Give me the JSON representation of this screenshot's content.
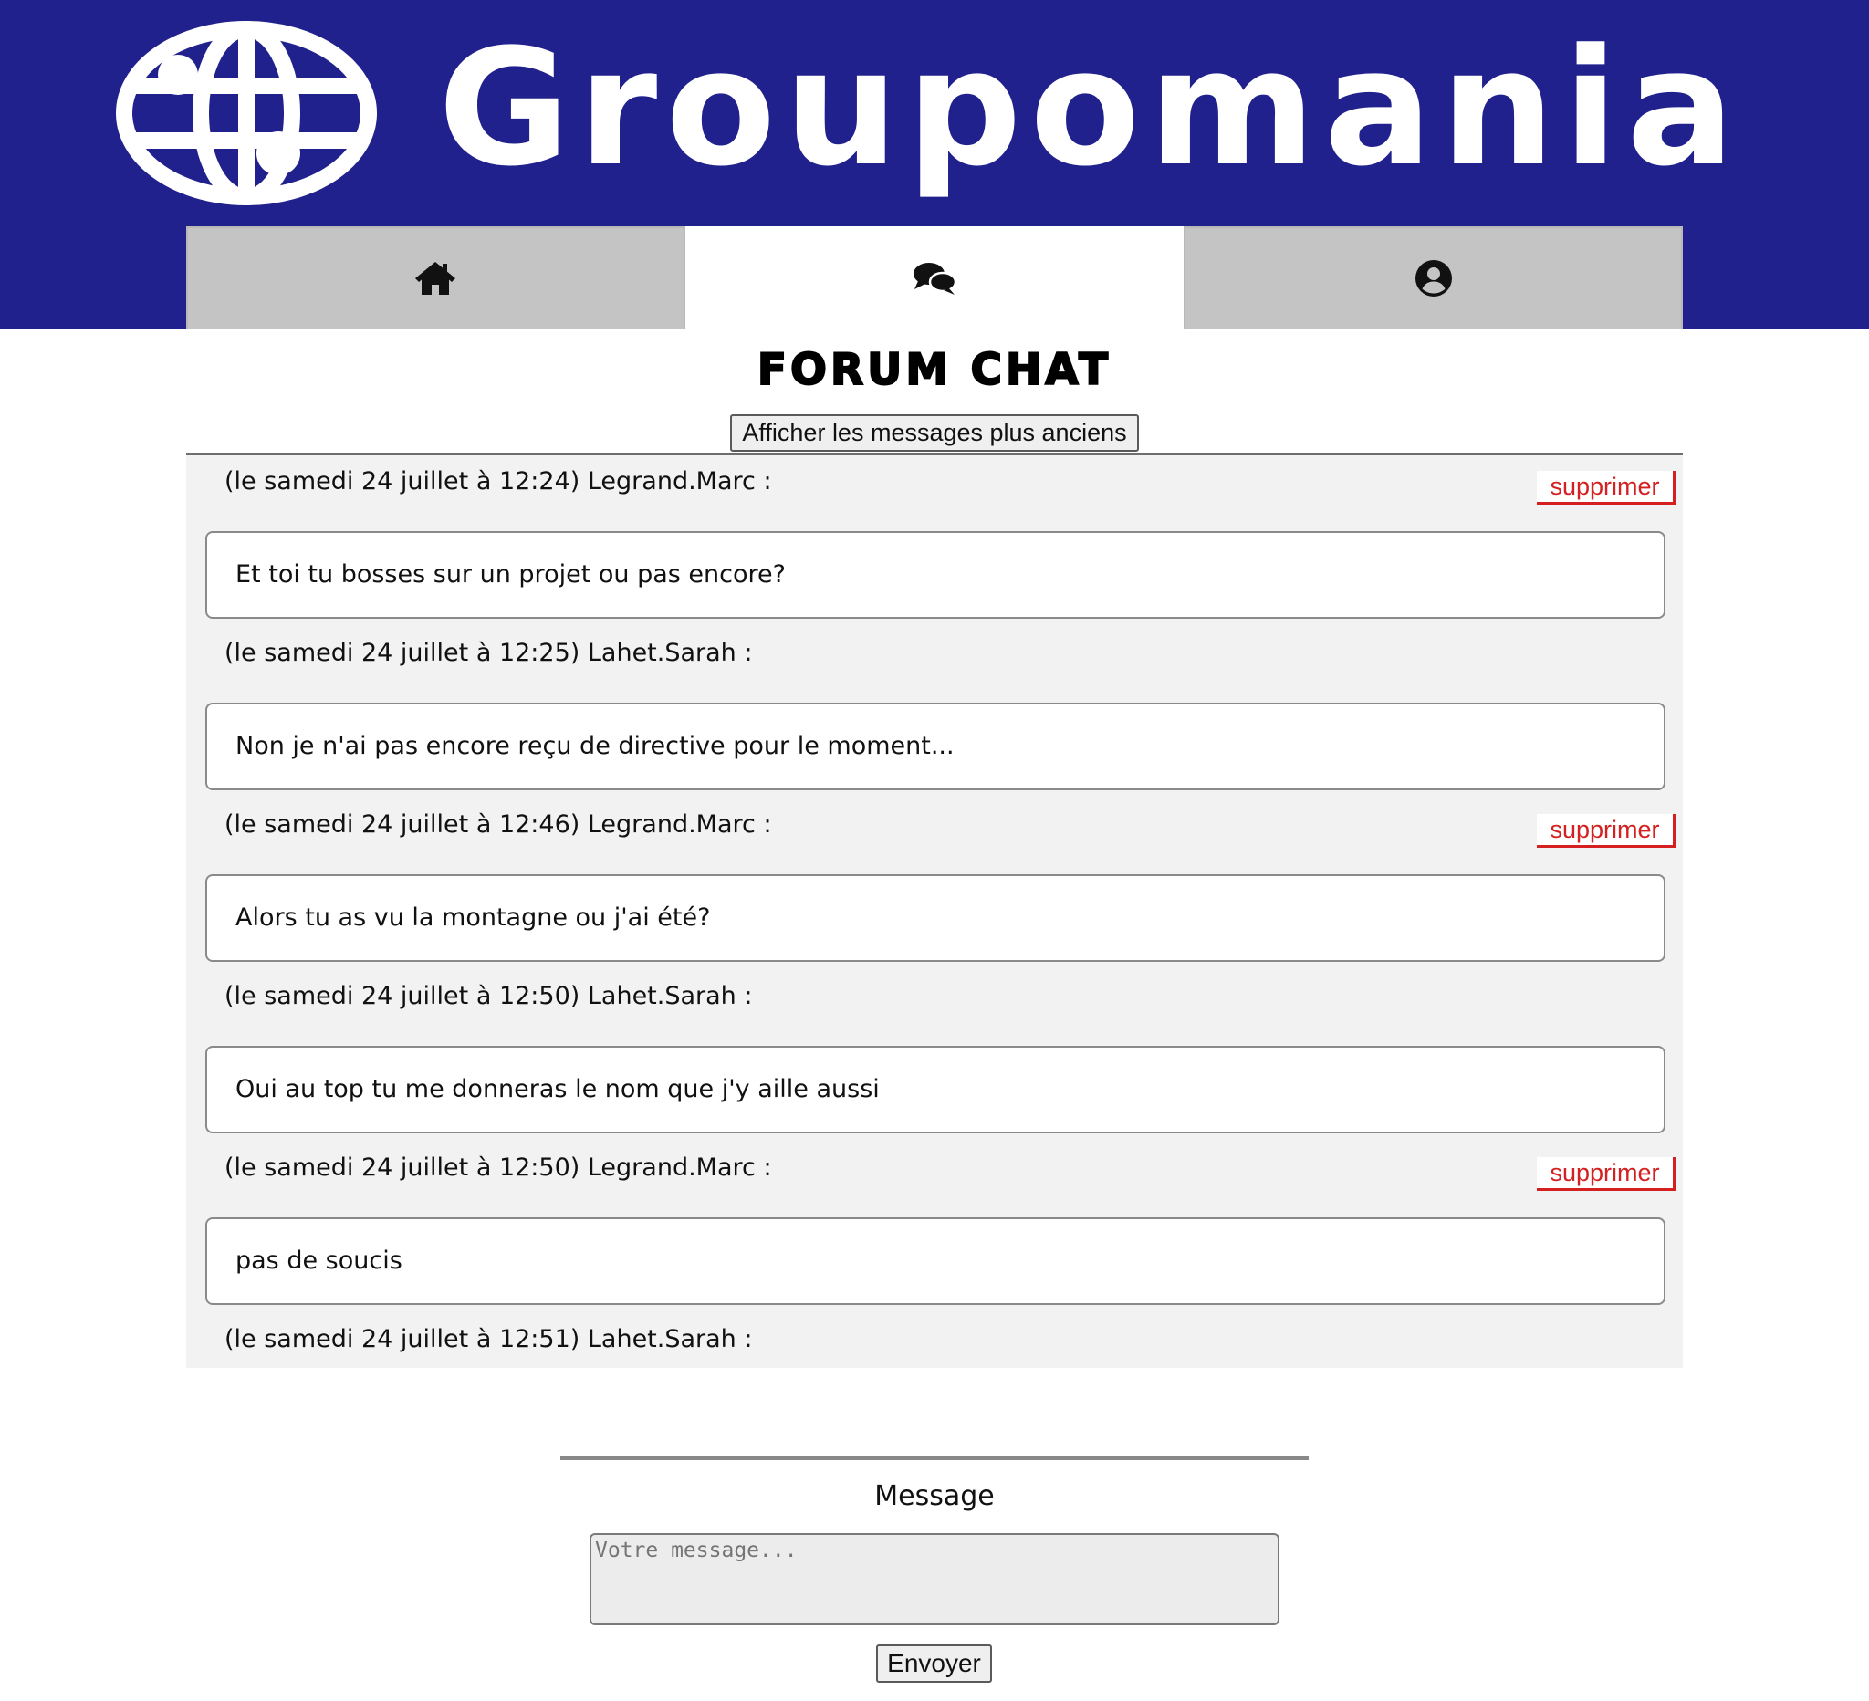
{
  "app": {
    "name": "Groupomania",
    "logo_icon": "globe-icon",
    "brand_color": "#21218e"
  },
  "nav": {
    "tabs": [
      {
        "icon": "home-icon",
        "active": false
      },
      {
        "icon": "chat-bubbles-icon",
        "active": true
      },
      {
        "icon": "user-circle-icon",
        "active": false
      }
    ]
  },
  "page": {
    "title": "FORUM CHAT",
    "older_label": "Afficher les messages plus anciens"
  },
  "messages": [
    {
      "meta": "(le samedi 24 juillet à 12:24) Legrand.Marc :",
      "text": "Et toi tu bosses sur un projet ou pas encore?",
      "deletable": true
    },
    {
      "meta": "(le samedi 24 juillet à 12:25) Lahet.Sarah :",
      "text": "Non je n'ai pas encore reçu de directive pour le moment...",
      "deletable": false
    },
    {
      "meta": "(le samedi 24 juillet à 12:46) Legrand.Marc :",
      "text": "Alors tu as vu la montagne ou j'ai été?",
      "deletable": true
    },
    {
      "meta": "(le samedi 24 juillet à 12:50) Lahet.Sarah :",
      "text": "Oui au top tu me donneras le nom que j'y aille aussi",
      "deletable": false
    },
    {
      "meta": "(le samedi 24 juillet à 12:50) Legrand.Marc :",
      "text": "pas de soucis",
      "deletable": true
    },
    {
      "meta": "(le samedi 24 juillet à 12:51) Lahet.Sarah :",
      "text": "",
      "deletable": false
    }
  ],
  "delete_label": "supprimer",
  "delete_color": "#d42020",
  "composer": {
    "label": "Message",
    "placeholder": "Votre message...",
    "value": "",
    "send_label": "Envoyer"
  }
}
